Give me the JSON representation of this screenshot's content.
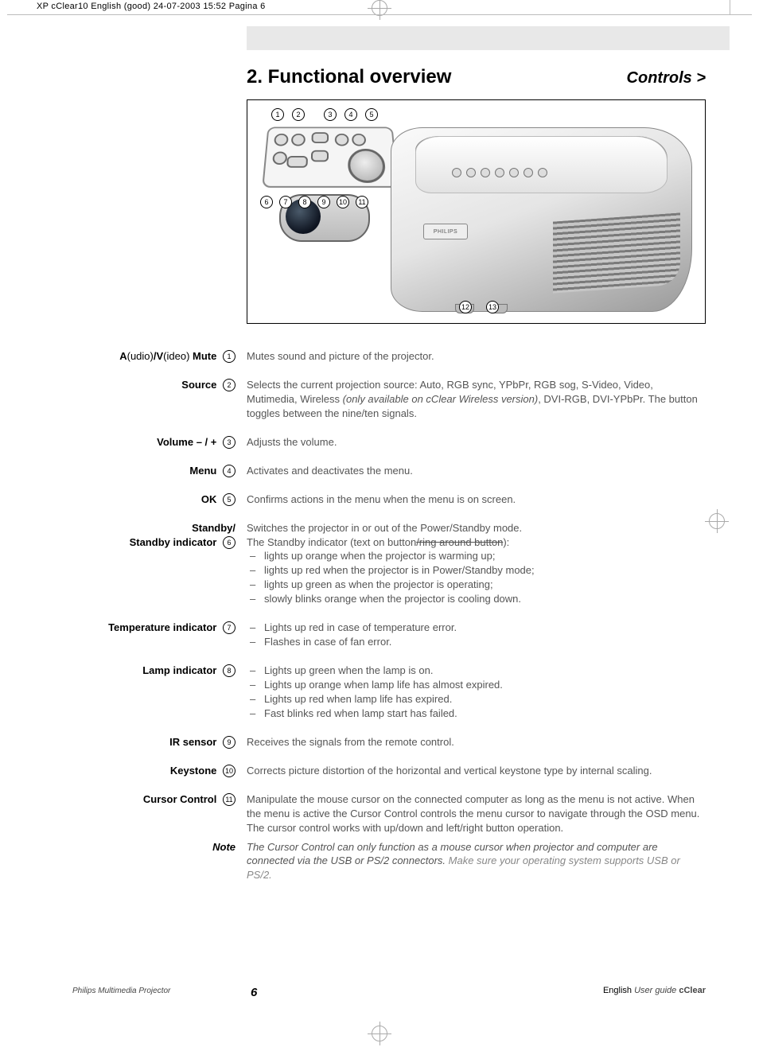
{
  "crop_header": "XP cClear10 English (good)  24-07-2003  15:52  Pagina 6",
  "section_number_title": "2. Functional overview",
  "section_subtitle": "Controls >",
  "figure": {
    "top_nums": [
      "1",
      "2",
      "3",
      "4",
      "5"
    ],
    "mid_nums": [
      "6",
      "7",
      "8",
      "9",
      "10",
      "11"
    ],
    "bottom_nums": [
      "12",
      "13"
    ],
    "brand_badge": "PHILIPS"
  },
  "rows": [
    {
      "label_html": "<b>A</b><span class='thin'>(udio)</span><b>/V</b><span class='thin'>(ideo)</span> <b>Mute</b>",
      "num": "1",
      "desc": "Mutes sound and picture of the projector."
    },
    {
      "label_html": "<b>Source</b>",
      "num": "2",
      "desc": "Selects the current projection source: Auto, RGB sync, YPbPr, RGB sog, S-Video, Video, Mutimedia, Wireless <em>(only available on cClear Wireless version)</em>, DVI-RGB, DVI-YPbPr. The button toggles between the nine/ten signals."
    },
    {
      "label_html": "<b>Volume – / +</b>",
      "num": "3",
      "desc": "Adjusts the volume."
    },
    {
      "label_html": "<b>Menu</b>",
      "num": "4",
      "desc": "Activates and deactivates the menu."
    },
    {
      "label_html": "<b>OK</b>",
      "num": "5",
      "desc": "Confirms actions in the menu when the menu is on screen."
    }
  ],
  "standby": {
    "label_line1": "Standby/",
    "label_line2": "Standby indicator",
    "num": "6",
    "line1": "Switches the projector in or out of the Power/Standby mode.",
    "line2_pre": "The Standby indicator (text on button",
    "line2_strike": "/ring around button",
    "line2_post": "):",
    "bullets": [
      "lights up orange when the projector is warming up;",
      "lights up red when the projector is in Power/Standby mode;",
      "lights up green as when the projector is operating;",
      "slowly blinks orange when the projector is cooling down."
    ]
  },
  "temp": {
    "label": "Temperature indicator",
    "num": "7",
    "bullets": [
      "Lights up red in case of temperature error.",
      "Flashes in case of fan error."
    ]
  },
  "lamp": {
    "label": "Lamp indicator",
    "num": "8",
    "bullets": [
      "Lights up green when the lamp is on.",
      "Lights up orange when lamp life has almost expired.",
      "Lights up red when lamp life has expired.",
      "Fast blinks red when lamp start has failed."
    ]
  },
  "ir": {
    "label": "IR sensor",
    "num": "9",
    "desc": "Receives the signals from the remote control."
  },
  "keystone": {
    "label": "Keystone",
    "num": "10",
    "desc": "Corrects picture distortion of the horizontal and vertical keystone type by internal scaling."
  },
  "cursor": {
    "label": "Cursor Control",
    "num": "11",
    "desc": "Manipulate the mouse cursor on the connected computer as long as the menu is not active. When the menu is active the Cursor Control controls the menu cursor to navigate through the OSD menu. The cursor control works with up/down and left/right button operation.",
    "note_label": "Note",
    "note_em": "The Cursor Control can only function as a mouse cursor when projector and computer are connected via the USB or PS/2 connectors.",
    "note_tail": " Make sure your operating system supports USB or PS/2."
  },
  "footer": {
    "left": "Philips Multimedia Projector",
    "center": "6",
    "right_plain": "English ",
    "right_ital": "User guide  ",
    "right_brand": "cClear"
  }
}
